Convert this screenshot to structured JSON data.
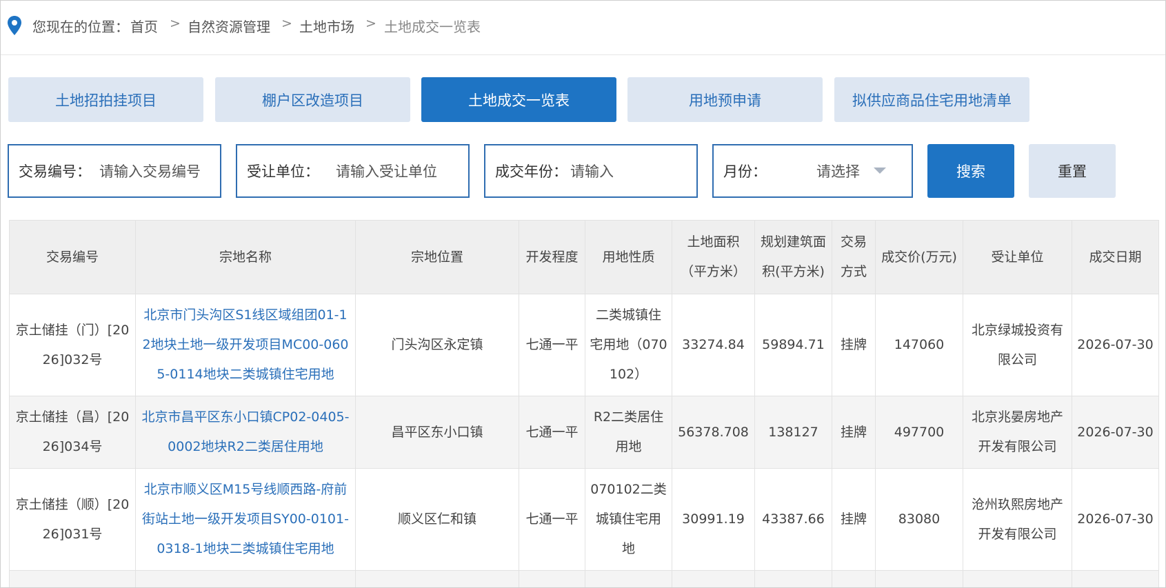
{
  "breadcrumb": {
    "label": "您现在的位置：",
    "items": [
      "首页",
      "自然资源管理",
      "土地市场",
      "土地成交一览表"
    ],
    "separator": ">"
  },
  "tabs": [
    {
      "label": "土地招拍挂项目",
      "active": false
    },
    {
      "label": "棚户区改造项目",
      "active": false
    },
    {
      "label": "土地成交一览表",
      "active": true
    },
    {
      "label": "用地预申请",
      "active": false
    },
    {
      "label": "拟供应商品住宅用地清单",
      "active": false
    }
  ],
  "filters": {
    "trade_no": {
      "label": "交易编号：",
      "placeholder": "请输入交易编号"
    },
    "assignee": {
      "label": "受让单位：",
      "placeholder": "请输入受让单位"
    },
    "year": {
      "label": "成交年份：",
      "placeholder": "请输入"
    },
    "month": {
      "label": "月份：",
      "placeholder": "请选择"
    }
  },
  "buttons": {
    "search": "搜索",
    "reset": "重置"
  },
  "table": {
    "headers": {
      "trade_no": "交易编号",
      "name": "宗地名称",
      "location": "宗地位置",
      "dev_level": "开发程度",
      "land_use": "用地性质",
      "area_l1": "土地面积",
      "area_l2": "（平方米）",
      "floor_area_l1": "规划建筑面",
      "floor_area_l2": "积(平方米)",
      "method_l1": "交易",
      "method_l2": "方式",
      "price": "成交价(万元)",
      "assignee": "受让单位",
      "date": "成交日期"
    },
    "rows": [
      {
        "trade_no": "京土储挂（门）[2026]032号",
        "name": "北京市门头沟区S1线区域组团01-12地块土地一级开发项目MC00-0605-0114地块二类城镇住宅用地",
        "location": "门头沟区永定镇",
        "dev_level": "七通一平",
        "land_use": "二类城镇住宅用地（070102）",
        "area": "33274.84",
        "floor_area": "59894.71",
        "method": "挂牌",
        "price": "147060",
        "assignee": "北京绿城投资有限公司",
        "date": "2026-07-30"
      },
      {
        "trade_no": "京土储挂（昌）[2026]034号",
        "name": "北京市昌平区东小口镇CP02-0405-0002地块R2二类居住用地",
        "location": "昌平区东小口镇",
        "dev_level": "七通一平",
        "land_use": "R2二类居住用地",
        "area": "56378.708",
        "floor_area": "138127",
        "method": "挂牌",
        "price": "497700",
        "assignee": "北京兆晏房地产开发有限公司",
        "date": "2026-07-30"
      },
      {
        "trade_no": "京土储挂（顺）[2026]031号",
        "name": "北京市顺义区M15号线顺西路-府前街站土地一级开发项目SY00-0101-0318-1地块二类城镇住宅用地",
        "location": "顺义区仁和镇",
        "dev_level": "七通一平",
        "land_use": "070102二类城镇住宅用地",
        "area": "30991.19",
        "floor_area": "43387.66",
        "method": "挂牌",
        "price": "83080",
        "assignee": "沧州玖熙房地产开发有限公司",
        "date": "2026-07-30"
      }
    ]
  },
  "colors": {
    "primary": "#1e74c4",
    "tab_bg": "#dde6f2",
    "link": "#2a6fb9",
    "border": "#2f6db1"
  }
}
